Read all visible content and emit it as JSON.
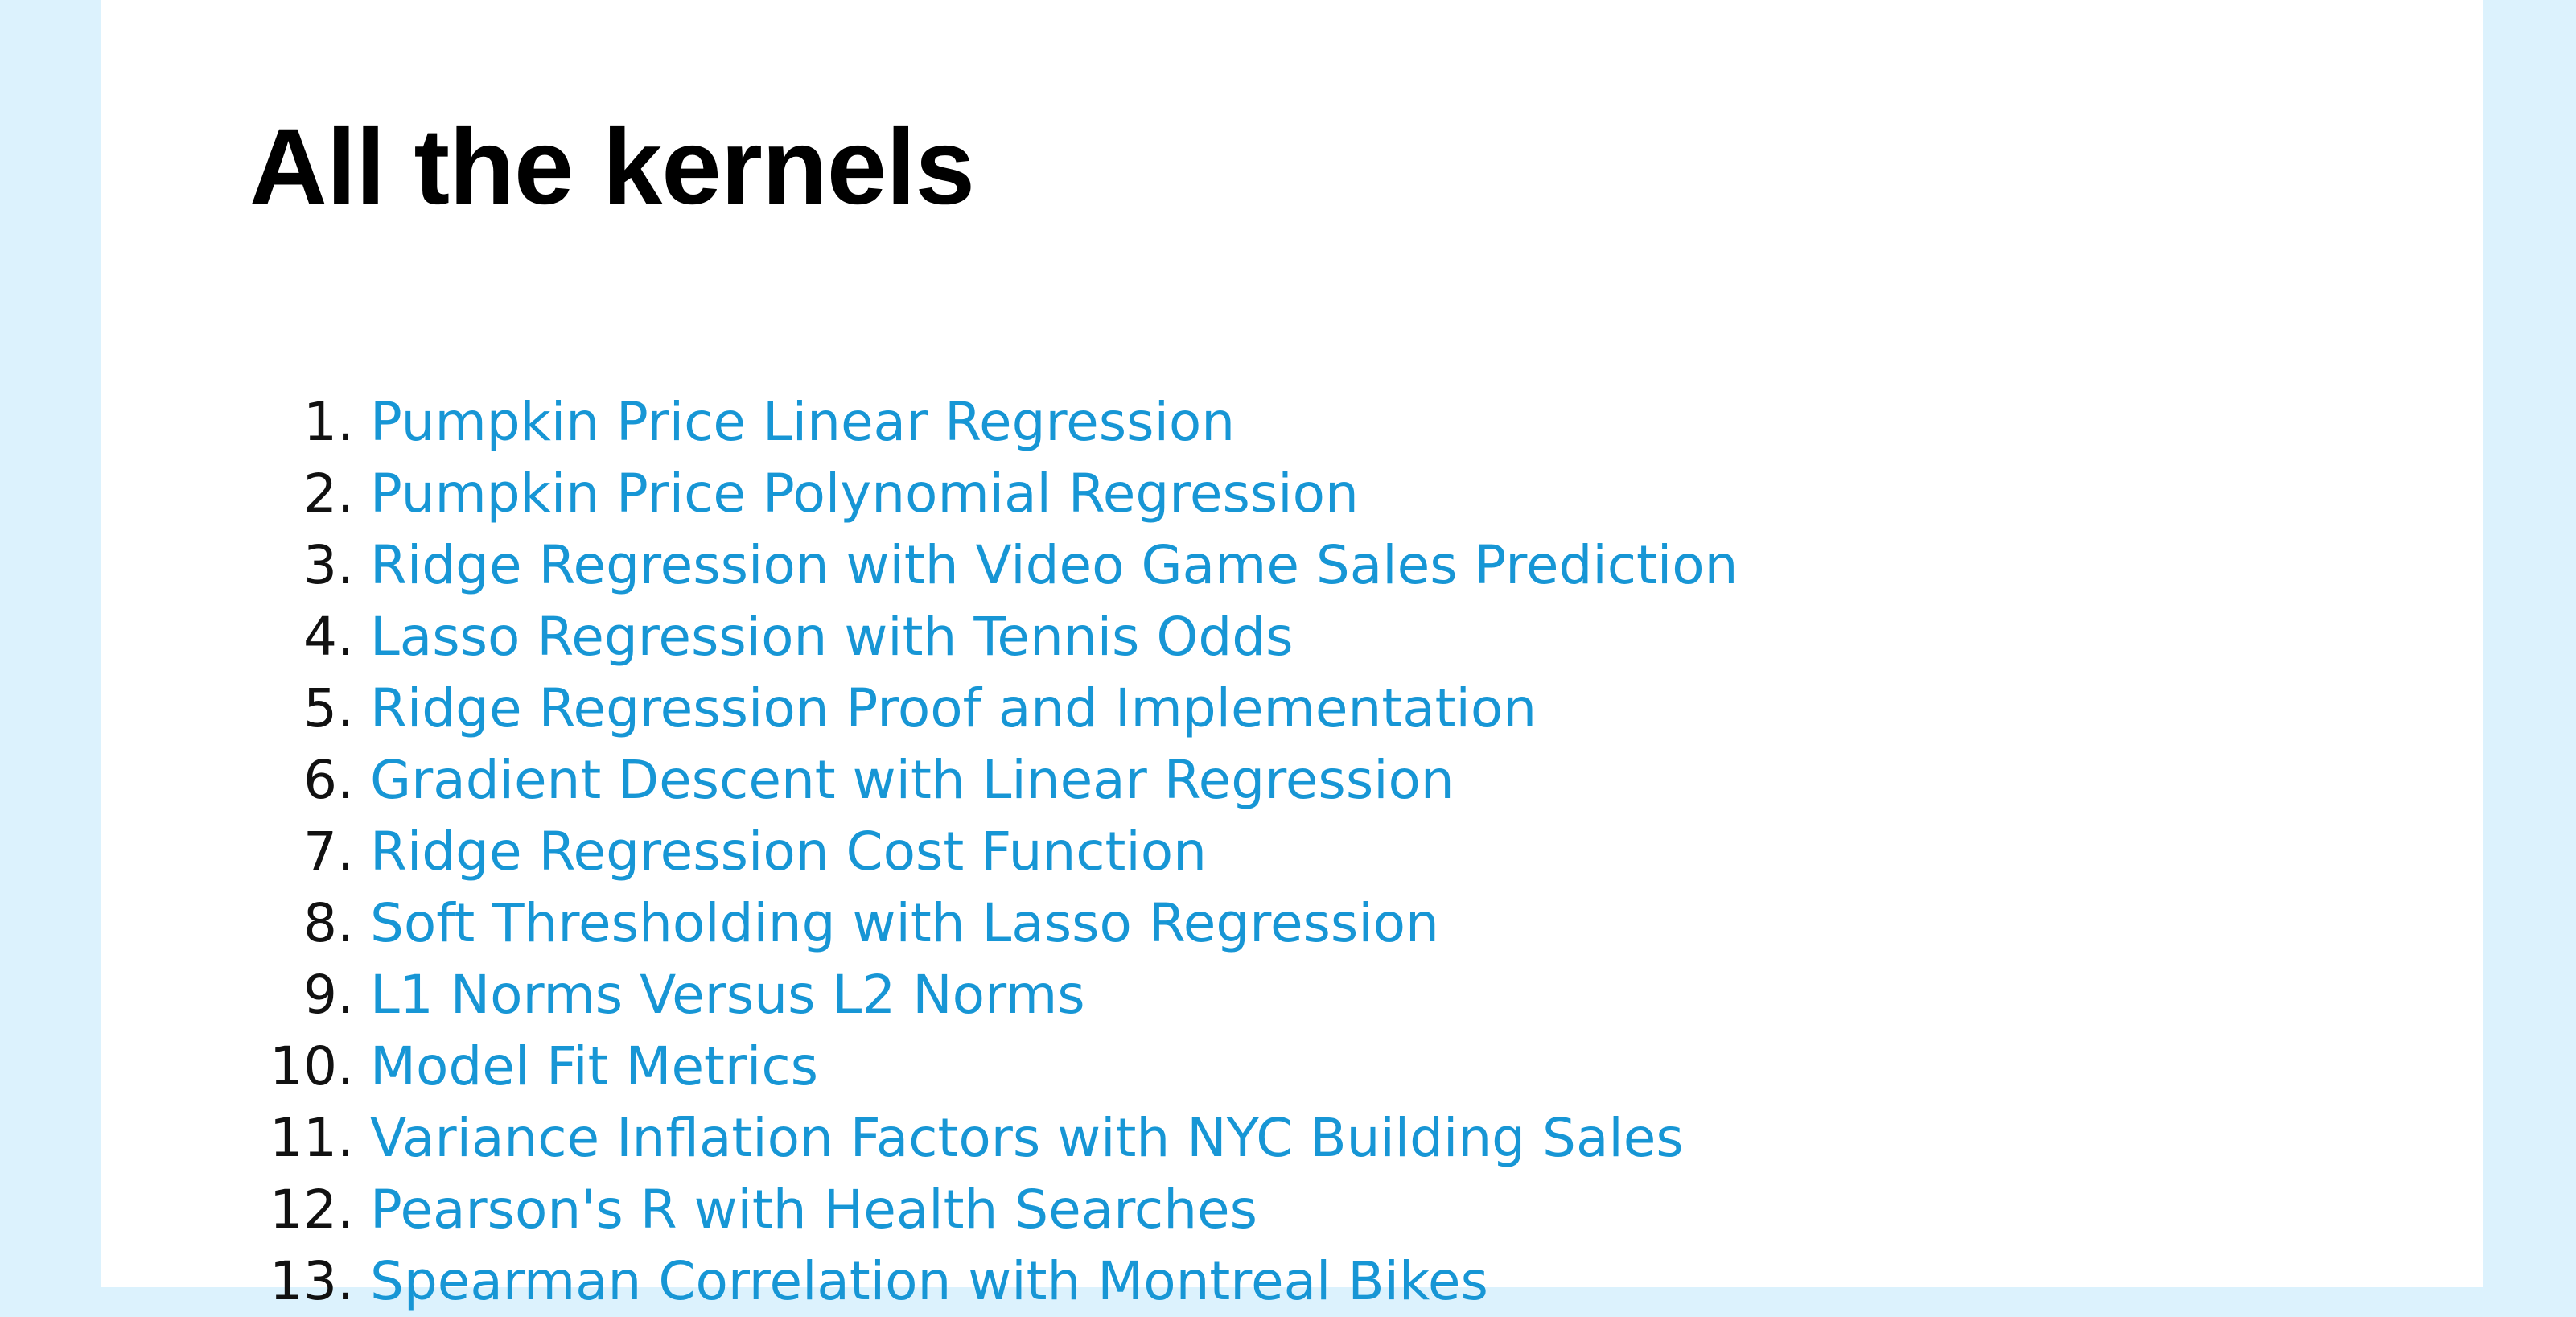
{
  "page": {
    "title": "All the kernels"
  },
  "colors": {
    "background": "#dcf2fd",
    "panel": "#ffffff",
    "link": "#1796d5",
    "text": "#000000"
  },
  "kernels": [
    {
      "num": "1.",
      "label": "Pumpkin Price Linear Regression"
    },
    {
      "num": "2.",
      "label": "Pumpkin Price Polynomial Regression"
    },
    {
      "num": "3.",
      "label": "Ridge Regression with Video Game Sales Prediction"
    },
    {
      "num": "4.",
      "label": "Lasso Regression with Tennis Odds"
    },
    {
      "num": "5.",
      "label": "Ridge Regression Proof and Implementation"
    },
    {
      "num": "6.",
      "label": "Gradient Descent with Linear Regression"
    },
    {
      "num": "7.",
      "label": "Ridge Regression Cost Function"
    },
    {
      "num": "8.",
      "label": "Soft Thresholding with Lasso Regression"
    },
    {
      "num": "9.",
      "label": "L1 Norms Versus L2 Norms"
    },
    {
      "num": "10.",
      "label": "Model Fit Metrics"
    },
    {
      "num": "11.",
      "label": "Variance Inflation Factors with NYC Building Sales"
    },
    {
      "num": "12.",
      "label": "Pearson's R with Health Searches"
    },
    {
      "num": "13.",
      "label": "Spearman Correlation with Montreal Bikes"
    }
  ]
}
